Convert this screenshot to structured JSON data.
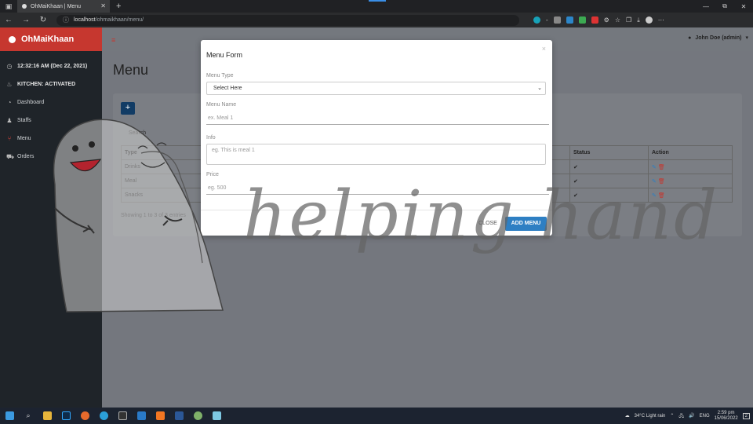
{
  "browser": {
    "tab_title": "OhMaiKhaan | Menu",
    "url_host": "localhost",
    "url_path": "/ohmaikhaan/menu/",
    "win_min": "—",
    "win_max": "⧉",
    "win_close": "✕"
  },
  "sidebar": {
    "brand": "OhMaiKhaan",
    "clock": "12:32:16 AM (Dec 22, 2021)",
    "kitchen_status": "KITCHEN: ACTIVATED",
    "items": [
      {
        "label": "Dashboard",
        "icon": "dashboard-icon"
      },
      {
        "label": "Staffs",
        "icon": "staff-icon"
      },
      {
        "label": "Menu",
        "icon": "menu-icon"
      },
      {
        "label": "Orders",
        "icon": "cart-icon"
      }
    ]
  },
  "topnav": {
    "user": "John Doe (admin)"
  },
  "page": {
    "title": "Menu",
    "add_button": "+",
    "search_label": "Search",
    "columns": [
      "Type",
      "",
      "Status",
      "Action"
    ],
    "rows": [
      {
        "type": "Drinks"
      },
      {
        "type": "Meal"
      },
      {
        "type": "Snacks"
      }
    ],
    "showing": "Showing 1 to 3 of 3 entries"
  },
  "modal": {
    "title": "Menu Form",
    "close_x": "×",
    "menu_type_label": "Menu Type",
    "menu_type_value": "Select Here",
    "menu_name_label": "Menu Name",
    "menu_name_placeholder": "ex. Meal 1",
    "info_label": "Info",
    "info_placeholder": "eg. This is meal 1",
    "price_label": "Price",
    "price_placeholder": "eg. 500",
    "close_button": "CLOSE",
    "add_button": "ADD MENU"
  },
  "watermark": {
    "text": "helping hand"
  },
  "taskbar": {
    "weather": "34°C  Light rain",
    "lang": "ENG",
    "time": "2:59 pm",
    "date": "15/06/2022",
    "notifications": "2"
  },
  "colors": {
    "brand_red": "#c6372f",
    "sidebar_bg": "#1f2429",
    "primary_blue": "#2e7fc3",
    "dark_blue": "#123c65"
  }
}
